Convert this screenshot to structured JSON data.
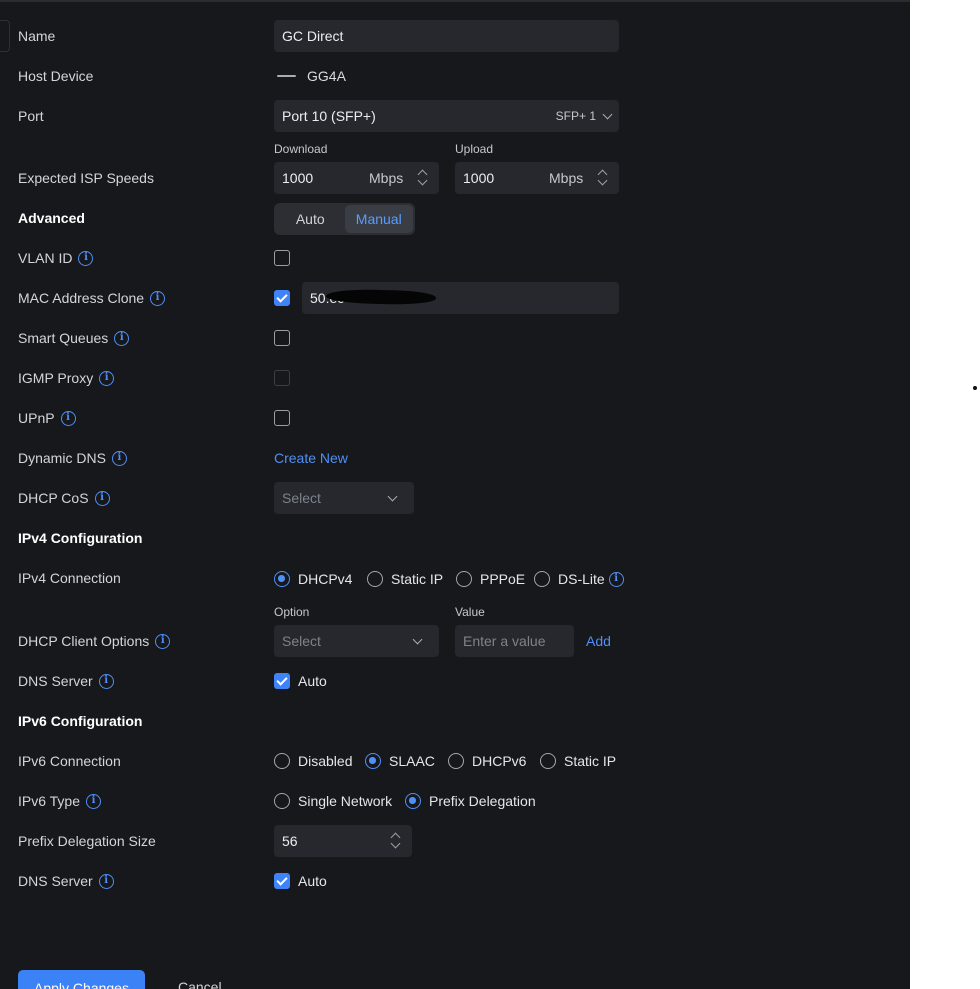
{
  "form": {
    "name": {
      "label": "Name",
      "value": "GC Direct"
    },
    "host_device": {
      "label": "Host Device",
      "value": "GG4A",
      "icon": "device-line-icon"
    },
    "port": {
      "label": "Port",
      "value": "Port 10 (SFP+)",
      "badge": "SFP+ 1"
    },
    "isp_speeds": {
      "label": "Expected ISP Speeds",
      "download_label": "Download",
      "download_value": "1000",
      "upload_label": "Upload",
      "upload_value": "1000",
      "unit": "Mbps"
    },
    "advanced": {
      "label": "Advanced",
      "options": [
        "Auto",
        "Manual"
      ],
      "selected": "Manual"
    },
    "vlan_id": {
      "label": "VLAN ID",
      "checked": false
    },
    "mac_clone": {
      "label": "MAC Address Clone",
      "checked": true,
      "value": "50:ec"
    },
    "smart_queues": {
      "label": "Smart Queues",
      "checked": false
    },
    "igmp_proxy": {
      "label": "IGMP Proxy",
      "checked": false,
      "disabled": true
    },
    "upnp": {
      "label": "UPnP",
      "checked": false
    },
    "dynamic_dns": {
      "label": "Dynamic DNS",
      "link": "Create New"
    },
    "dhcp_cos": {
      "label": "DHCP CoS",
      "placeholder": "Select"
    },
    "ipv4_section": "IPv4 Configuration",
    "ipv4_connection": {
      "label": "IPv4 Connection",
      "options": [
        "DHCPv4",
        "Static IP",
        "PPPoE",
        "DS-Lite"
      ],
      "selected": "DHCPv4"
    },
    "dhcp_client_options": {
      "label": "DHCP Client Options",
      "option_label": "Option",
      "option_placeholder": "Select",
      "value_label": "Value",
      "value_placeholder": "Enter a value",
      "add": "Add"
    },
    "dns_server_v4": {
      "label": "DNS Server",
      "checked": true,
      "text": "Auto"
    },
    "ipv6_section": "IPv6 Configuration",
    "ipv6_connection": {
      "label": "IPv6 Connection",
      "options": [
        "Disabled",
        "SLAAC",
        "DHCPv6",
        "Static IP"
      ],
      "selected": "SLAAC"
    },
    "ipv6_type": {
      "label": "IPv6 Type",
      "options": [
        "Single Network",
        "Prefix Delegation"
      ],
      "selected": "Prefix Delegation"
    },
    "prefix_size": {
      "label": "Prefix Delegation Size",
      "value": "56"
    },
    "dns_server_v6": {
      "label": "DNS Server",
      "checked": true,
      "text": "Auto"
    }
  },
  "actions": {
    "apply": "Apply Changes",
    "cancel": "Cancel"
  },
  "colors": {
    "background": "#17181b",
    "field": "#26282d",
    "accent": "#3f83f8",
    "text": "#d3d5d9"
  }
}
